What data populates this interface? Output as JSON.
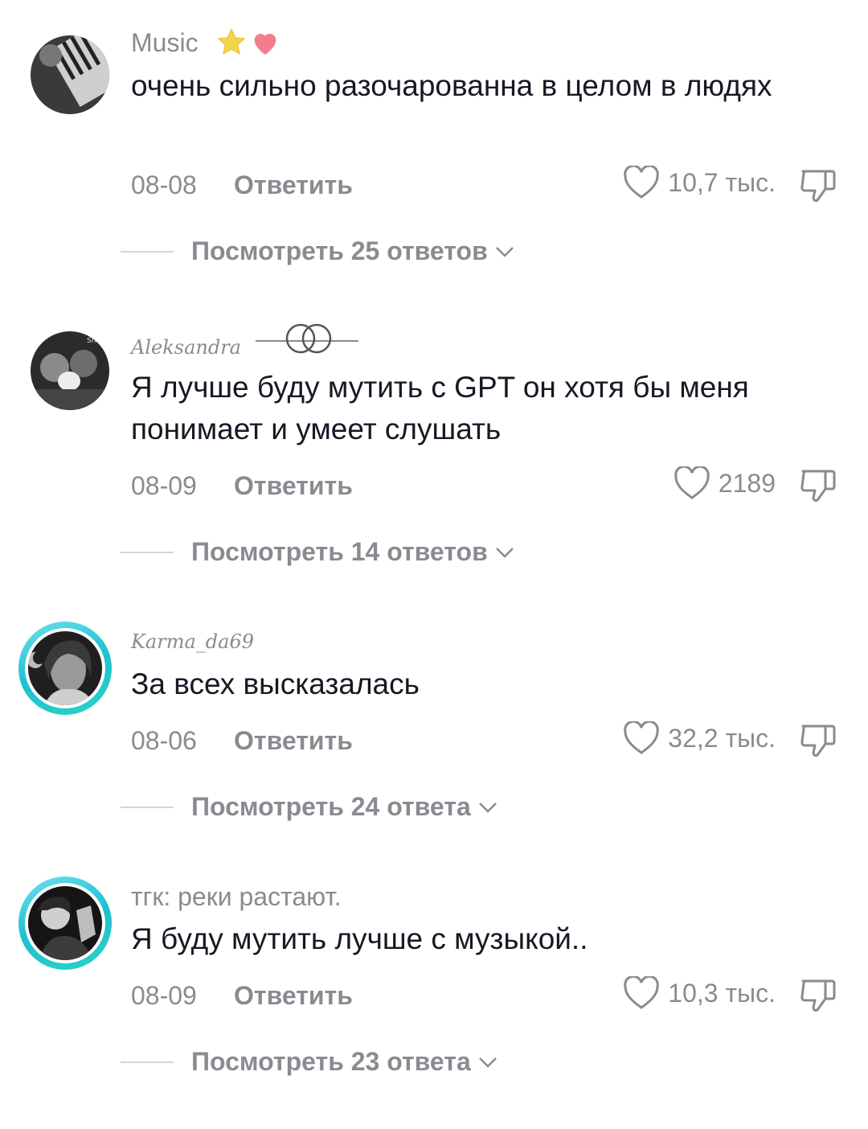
{
  "comments": [
    {
      "username": "Music",
      "text": "очень сильно разочарованна в целом в людях",
      "date": "08-08",
      "reply_label": "Ответить",
      "likes": "10,7 тыс.",
      "view_replies": "Посмотреть 25 ответов"
    },
    {
      "username": "Aleksandra",
      "avatar_caption": "Shifting",
      "text": "Я лучше буду мутить с GPT он хотя бы меня понимает и умеет слушать",
      "date": "08-09",
      "reply_label": "Ответить",
      "likes": "2189",
      "view_replies": "Посмотреть 14 ответов"
    },
    {
      "username": "Karma_da69",
      "text": "За всех высказалась",
      "date": "08-06",
      "reply_label": "Ответить",
      "likes": "32,2 тыс.",
      "view_replies": "Посмотреть 24 ответа"
    },
    {
      "username": "тгк: реки растают.",
      "text": "Я буду мутить лучше с музыкой..",
      "date": "08-09",
      "reply_label": "Ответить",
      "likes": "10,3 тыс.",
      "view_replies": "Посмотреть 23 ответа"
    }
  ],
  "icons": {
    "like": "heart-outline-icon",
    "dislike": "thumbs-down-icon",
    "expand": "chevron-down-icon",
    "badges": [
      "star-icon",
      "heart-icon"
    ],
    "name_decoration": "interlocked-rings-icon"
  },
  "colors": {
    "text_primary": "#161823",
    "text_secondary": "#8a8b91",
    "story_ring": "#1ec0cf",
    "star": "#f5d547",
    "heart_badge": "#f47c8c"
  }
}
